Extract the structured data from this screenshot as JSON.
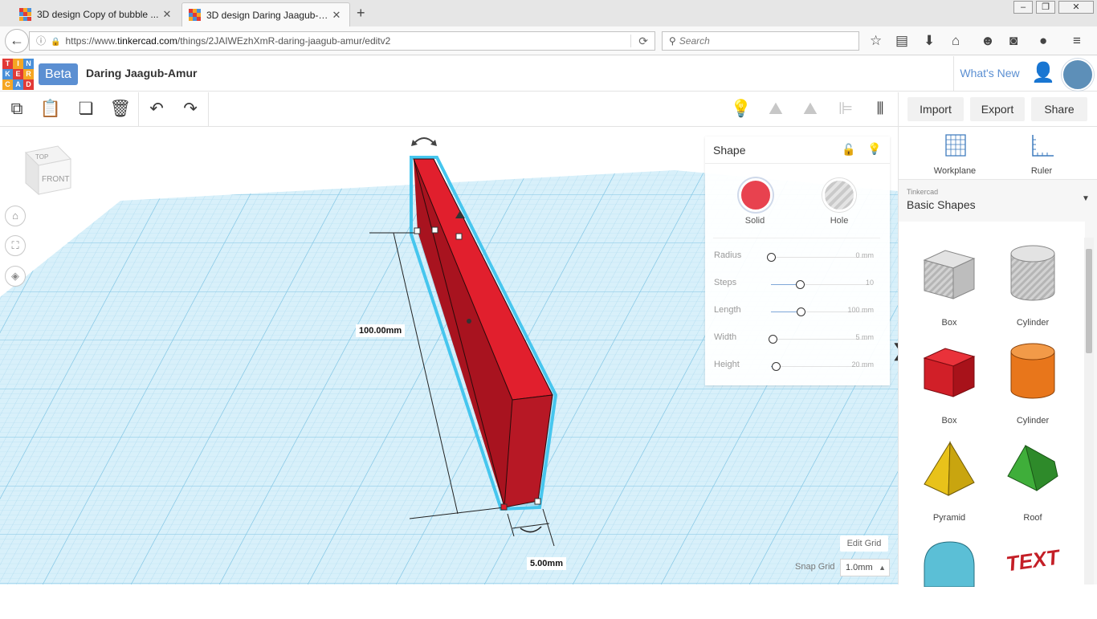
{
  "browser": {
    "tabs": [
      {
        "title": "3D design Copy of bubble ...",
        "active": false
      },
      {
        "title": "3D design Daring Jaagub-Amur...",
        "active": true
      }
    ],
    "url_prefix": "https://www.",
    "url_domain": "tinkercad.com",
    "url_path": "/things/2JAIWEzhXmR-daring-jaagub-amur/editv2",
    "search_placeholder": "Search"
  },
  "header": {
    "logo_letters": [
      "TIN",
      "KER",
      "CAD"
    ],
    "beta_label": "Beta",
    "design_name": "Daring Jaagub-Amur",
    "whats_new": "What's New"
  },
  "toolbar": {
    "import_label": "Import",
    "export_label": "Export",
    "share_label": "Share"
  },
  "viewcube": {
    "top": "TOP",
    "front": "FRONT"
  },
  "dimensions": {
    "height_label": "100.00mm",
    "width_label": "5.00mm"
  },
  "inspector": {
    "title": "Shape",
    "solid_label": "Solid",
    "hole_label": "Hole",
    "solid_color": "#e8424f",
    "params": [
      {
        "name": "Radius",
        "value": "0 mm",
        "fraction": 0.0
      },
      {
        "name": "Steps",
        "value": "10",
        "fraction": 0.3
      },
      {
        "name": "Length",
        "value": "100 mm",
        "fraction": 0.31
      },
      {
        "name": "Width",
        "value": "5 mm",
        "fraction": 0.02
      },
      {
        "name": "Height",
        "value": "20 mm",
        "fraction": 0.05
      }
    ]
  },
  "grid_controls": {
    "edit_grid": "Edit Grid",
    "snap_label": "Snap Grid",
    "snap_value": "1.0mm"
  },
  "right_panel": {
    "workplane_label": "Workplane",
    "ruler_label": "Ruler",
    "library_source": "Tinkercad",
    "library_name": "Basic Shapes",
    "shapes": [
      {
        "label": "Box",
        "icon": "box-hole-icon"
      },
      {
        "label": "Cylinder",
        "icon": "cylinder-hole-icon"
      },
      {
        "label": "Box",
        "icon": "box-icon"
      },
      {
        "label": "Cylinder",
        "icon": "cylinder-icon"
      },
      {
        "label": "Pyramid",
        "icon": "pyramid-icon"
      },
      {
        "label": "Roof",
        "icon": "roof-icon"
      }
    ],
    "text_shape_label": "TEXT"
  },
  "colors": {
    "grid_blue": "#bfe6f5",
    "selected_red": "#e11f2d",
    "accent_blue": "#5b8fd2"
  }
}
